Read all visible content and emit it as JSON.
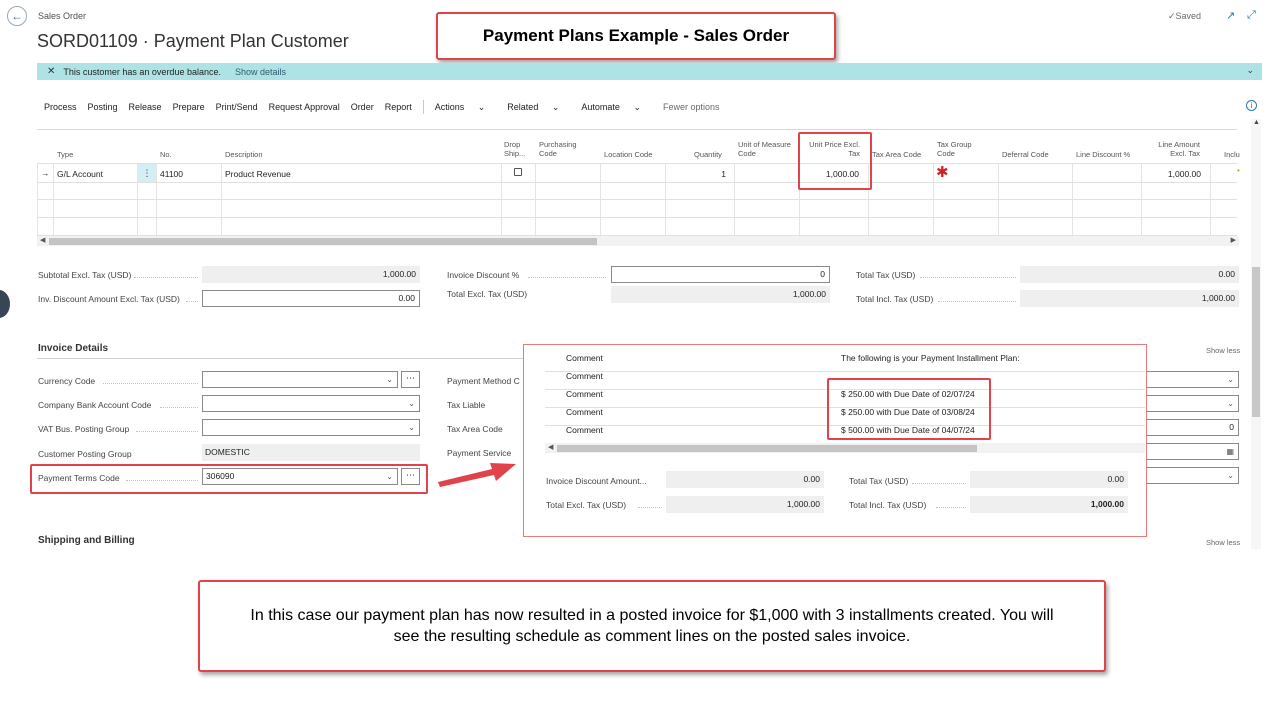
{
  "header": {
    "breadcrumb": "Sales Order",
    "title": "SORD01109 · Payment Plan Customer",
    "saved": "Saved"
  },
  "callouts": {
    "title": "Payment Plans Example - Sales Order",
    "note": "In this case our payment plan has now resulted in a posted invoice for $1,000 with 3 installments created. You will see the resulting schedule as comment lines on the posted sales invoice."
  },
  "notification": {
    "message": "This customer has an overdue balance.",
    "link": "Show details"
  },
  "actions": {
    "items": [
      "Process",
      "Posting",
      "Release",
      "Prepare",
      "Print/Send",
      "Request Approval",
      "Order",
      "Report"
    ],
    "actions": "Actions",
    "related": "Related",
    "automate": "Automate",
    "fewer": "Fewer options"
  },
  "lines": {
    "headers": {
      "type": "Type",
      "no": "No.",
      "description": "Description",
      "drop_ship": "Drop Ship...",
      "purchasing_code": "Purchasing Code",
      "location_code": "Location Code",
      "quantity": "Quantity",
      "uom": "Unit of Measure Code",
      "unit_price": "Unit Price Excl. Tax",
      "tax_area": "Tax Area Code",
      "tax_group": "Tax Group Code",
      "deferral": "Deferral Code",
      "line_discount": "Line Discount %",
      "line_amount": "Line Amount Excl. Tax",
      "incl": "Inclu"
    },
    "row": {
      "type": "G/L Account",
      "no": "41100",
      "description": "Product Revenue",
      "quantity": "1",
      "unit_price": "1,000.00",
      "line_amount": "1,000.00"
    }
  },
  "totals": {
    "subtotal_label": "Subtotal Excl. Tax (USD)",
    "subtotal": "1,000.00",
    "inv_disc_amt_label": "Inv. Discount Amount Excl. Tax (USD)",
    "inv_disc_amt": "0.00",
    "inv_disc_pct_label": "Invoice Discount %",
    "inv_disc_pct": "0",
    "total_excl_label": "Total Excl. Tax (USD)",
    "total_excl": "1,000.00",
    "total_tax_label": "Total Tax (USD)",
    "total_tax": "0.00",
    "total_incl_label": "Total Incl. Tax (USD)",
    "total_incl": "1,000.00"
  },
  "invoice_details": {
    "title": "Invoice Details",
    "show_less": "Show less",
    "currency_code_label": "Currency Code",
    "company_bank_label": "Company Bank Account Code",
    "vat_bus_label": "VAT Bus. Posting Group",
    "customer_posting_label": "Customer Posting Group",
    "customer_posting_value": "DOMESTIC",
    "payment_terms_label": "Payment Terms Code",
    "payment_terms_value": "306090",
    "payment_method_label": "Payment Method C",
    "tax_liable_label": "Tax Liable",
    "tax_area_label": "Tax Area Code",
    "tax_area_value": "0",
    "payment_service_label": "Payment Service"
  },
  "shipping": {
    "title": "Shipping and Billing",
    "show_less": "Show less"
  },
  "overlay": {
    "rows": [
      {
        "type": "Comment",
        "desc": "The following is your Payment Installment Plan:"
      },
      {
        "type": "Comment",
        "desc": ""
      },
      {
        "type": "Comment",
        "desc": "$ 250.00 with Due Date of 02/07/24"
      },
      {
        "type": "Comment",
        "desc": "$ 250.00 with Due Date of 03/08/24"
      },
      {
        "type": "Comment",
        "desc": "$ 500.00 with Due Date of 04/07/24"
      }
    ],
    "inv_disc_label": "Invoice Discount Amount...",
    "inv_disc": "0.00",
    "total_excl_label": "Total Excl. Tax (USD)",
    "total_excl": "1,000.00",
    "total_tax_label": "Total Tax (USD)",
    "total_tax": "0.00",
    "total_incl_label": "Total Incl. Tax (USD)",
    "total_incl": "1,000.00"
  },
  "colors": {
    "accent_red": "#e0444a",
    "notification_bg": "#aee3e6",
    "link_blue": "#2a7ab0"
  }
}
